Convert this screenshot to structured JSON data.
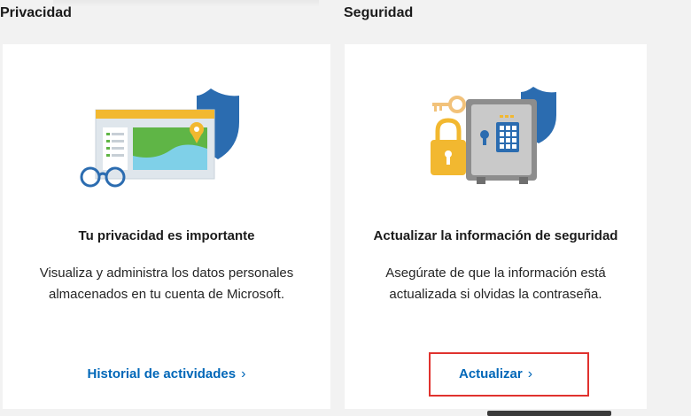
{
  "sections": {
    "privacy_title": "Privacidad",
    "security_title": "Seguridad"
  },
  "privacy_card": {
    "heading": "Tu privacidad es importante",
    "description": "Visualiza y administra los datos personales almacenados en tu cuenta de Microsoft.",
    "link_label": "Historial de actividades",
    "icon": "privacy-illustration"
  },
  "security_card": {
    "heading": "Actualizar la información de seguridad",
    "description": "Asegúrate de que la información está actualizada si olvidas la contraseña.",
    "link_label": "Actualizar",
    "icon": "security-illustration"
  },
  "chevron": "›",
  "colors": {
    "link": "#0067b8",
    "highlight": "#e0322e",
    "shield": "#2b6cb0"
  }
}
